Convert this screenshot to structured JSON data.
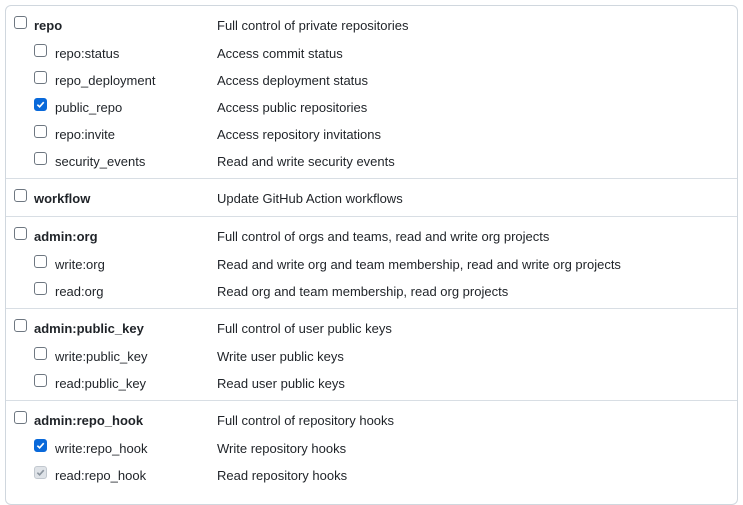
{
  "colors": {
    "accent": "#0969da",
    "border": "#d0d7de",
    "text": "#1f2328",
    "disabled_check": "#dfe3e8"
  },
  "scopes": [
    {
      "name": "repo",
      "description": "Full control of private repositories",
      "checked": false,
      "children": [
        {
          "name": "repo:status",
          "description": "Access commit status",
          "checked": false,
          "disabled": false
        },
        {
          "name": "repo_deployment",
          "description": "Access deployment status",
          "checked": false,
          "disabled": false
        },
        {
          "name": "public_repo",
          "description": "Access public repositories",
          "checked": true,
          "disabled": false
        },
        {
          "name": "repo:invite",
          "description": "Access repository invitations",
          "checked": false,
          "disabled": false
        },
        {
          "name": "security_events",
          "description": "Read and write security events",
          "checked": false,
          "disabled": false
        }
      ]
    },
    {
      "name": "workflow",
      "description": "Update GitHub Action workflows",
      "checked": false,
      "children": []
    },
    {
      "name": "admin:org",
      "description": "Full control of orgs and teams, read and write org projects",
      "checked": false,
      "children": [
        {
          "name": "write:org",
          "description": "Read and write org and team membership, read and write org projects",
          "checked": false,
          "disabled": false
        },
        {
          "name": "read:org",
          "description": "Read org and team membership, read org projects",
          "checked": false,
          "disabled": false
        }
      ]
    },
    {
      "name": "admin:public_key",
      "description": "Full control of user public keys",
      "checked": false,
      "children": [
        {
          "name": "write:public_key",
          "description": "Write user public keys",
          "checked": false,
          "disabled": false
        },
        {
          "name": "read:public_key",
          "description": "Read user public keys",
          "checked": false,
          "disabled": false
        }
      ]
    },
    {
      "name": "admin:repo_hook",
      "description": "Full control of repository hooks",
      "checked": false,
      "children": [
        {
          "name": "write:repo_hook",
          "description": "Write repository hooks",
          "checked": true,
          "disabled": false
        },
        {
          "name": "read:repo_hook",
          "description": "Read repository hooks",
          "checked": true,
          "disabled": true
        }
      ]
    }
  ]
}
